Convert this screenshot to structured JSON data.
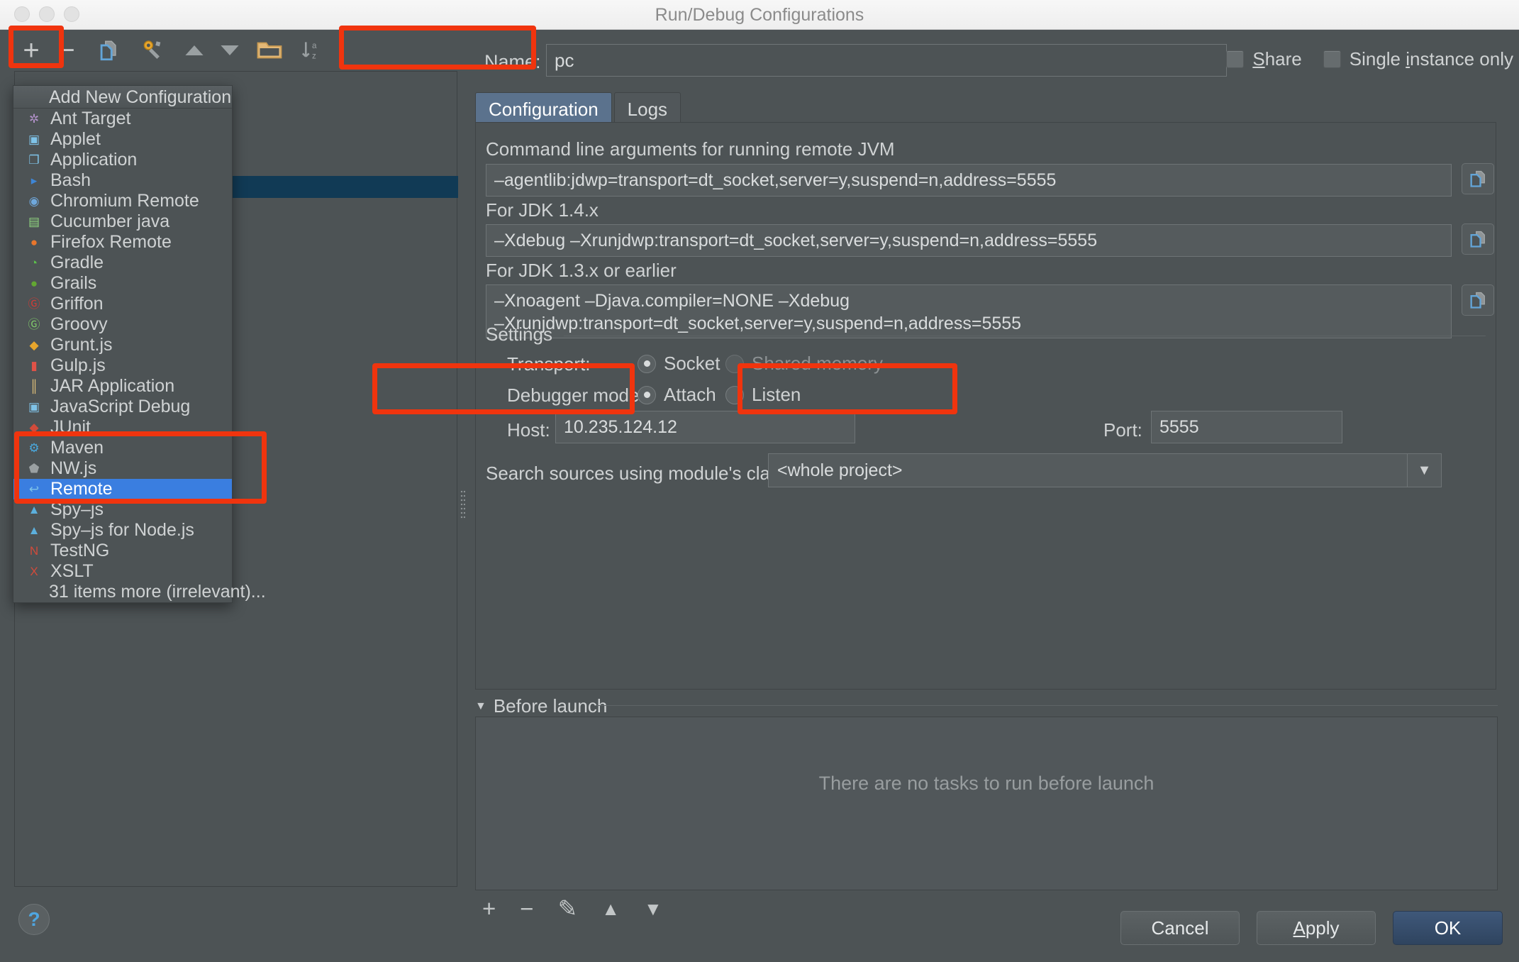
{
  "window": {
    "title": "Run/Debug Configurations"
  },
  "toolbar": {
    "add_label": "+",
    "remove_label": "−",
    "icons": [
      "copy-configuration-icon",
      "edit-templates-icon",
      "move-up-icon",
      "move-down-icon",
      "folder-icon",
      "sort-alphabetically-icon"
    ]
  },
  "menu": {
    "header": "Add New Configuration",
    "items": [
      {
        "label": "Ant Target",
        "icon": "ant-icon",
        "glyph": "✲",
        "color": "#b090c8"
      },
      {
        "label": "Applet",
        "icon": "applet-icon",
        "glyph": "▣",
        "color": "#7fc3e8"
      },
      {
        "label": "Application",
        "icon": "application-icon",
        "glyph": "❐",
        "color": "#7fc3e8"
      },
      {
        "label": "Bash",
        "icon": "bash-terminal-icon",
        "glyph": "▸",
        "color": "#3e86d6"
      },
      {
        "label": "Chromium Remote",
        "icon": "chromium-icon",
        "glyph": "◉",
        "color": "#6fa8dc"
      },
      {
        "label": "Cucumber java",
        "icon": "cucumber-icon",
        "glyph": "▤",
        "color": "#8fd47f"
      },
      {
        "label": "Firefox Remote",
        "icon": "firefox-icon",
        "glyph": "●",
        "color": "#e8762c"
      },
      {
        "label": "Gradle",
        "icon": "gradle-icon",
        "glyph": "◔",
        "color": "#5bbf4b"
      },
      {
        "label": "Grails",
        "icon": "grails-icon",
        "glyph": "●",
        "color": "#63a832"
      },
      {
        "label": "Griffon",
        "icon": "griffon-icon",
        "glyph": "Ⓖ",
        "color": "#d13b36"
      },
      {
        "label": "Groovy",
        "icon": "groovy-icon",
        "glyph": "Ⓖ",
        "color": "#7fc96a"
      },
      {
        "label": "Grunt.js",
        "icon": "grunt-icon",
        "glyph": "◆",
        "color": "#e8a62c"
      },
      {
        "label": "Gulp.js",
        "icon": "gulp-icon",
        "glyph": "▮",
        "color": "#e05247"
      },
      {
        "label": "JAR Application",
        "icon": "jar-icon",
        "glyph": "║",
        "color": "#e0c07a"
      },
      {
        "label": "JavaScript Debug",
        "icon": "javascript-debug-icon",
        "glyph": "▣",
        "color": "#7fc3e8"
      },
      {
        "label": "JUnit",
        "icon": "junit-icon",
        "glyph": "◆",
        "color": "#d14b3b"
      },
      {
        "label": "Maven",
        "icon": "maven-icon",
        "glyph": "⚙",
        "color": "#4aa8dd"
      },
      {
        "label": "NW.js",
        "icon": "nwjs-icon",
        "glyph": "⬟",
        "color": "#9aa0a2"
      },
      {
        "label": "Remote",
        "icon": "remote-icon",
        "glyph": "↩",
        "color": "#7fc3e8",
        "selected": true
      },
      {
        "label": "Spy–js",
        "icon": "spyjs-icon",
        "glyph": "▲",
        "color": "#5cb0dd"
      },
      {
        "label": "Spy–js for Node.js",
        "icon": "spyjs-node-icon",
        "glyph": "▲",
        "color": "#5cb0dd"
      },
      {
        "label": "TestNG",
        "icon": "testng-icon",
        "glyph": "N",
        "color": "#d14b3b"
      },
      {
        "label": "XSLT",
        "icon": "xslt-icon",
        "glyph": "X",
        "color": "#d14b3b"
      },
      {
        "label": "31 items more (irrelevant)...",
        "icon": "more-items-icon",
        "glyph": "",
        "color": "#cfd2d3",
        "no_icon": true
      }
    ]
  },
  "name_row": {
    "label": "Name:",
    "value": "pc",
    "share_label": "Share",
    "share_underline": "S",
    "single_instance_label": "Single instance only"
  },
  "tabs": [
    {
      "label": "Configuration",
      "active": true
    },
    {
      "label": "Logs",
      "active": false
    }
  ],
  "configuration": {
    "cmdline_label": "Command line arguments for running remote JVM",
    "cmdline_value": "–agentlib:jdwp=transport=dt_socket,server=y,suspend=n,address=5555",
    "jdk14_label": "For JDK 1.4.x",
    "jdk14_value": "–Xdebug –Xrunjdwp:transport=dt_socket,server=y,suspend=n,address=5555",
    "jdk13_label": "For JDK 1.3.x or earlier",
    "jdk13_value": "–Xnoagent –Djava.compiler=NONE –Xdebug\n–Xrunjdwp:transport=dt_socket,server=y,suspend=n,address=5555",
    "settings_group": "Settings",
    "transport_label": "Transport:",
    "transport_socket": "Socket",
    "transport_shared_memory": "Shared memory",
    "debugger_mode_label": "Debugger mode:",
    "debugger_attach": "Attach",
    "debugger_listen": "Listen",
    "host_label": "Host:",
    "host_value": "10.235.124.12",
    "port_label": "Port:",
    "port_value": "5555",
    "search_sources_label": "Search sources using module's classpath:",
    "search_sources_value": "<whole project>"
  },
  "before_launch": {
    "title": "Before launch",
    "empty_text": "There are no tasks to run before launch",
    "toolbar": [
      "+",
      "−",
      "✎",
      "▲",
      "▼"
    ]
  },
  "footer": {
    "help_label": "?",
    "cancel_label": "Cancel",
    "apply_label": "Apply",
    "apply_underline": "A",
    "ok_label": "OK"
  },
  "colors": {
    "accent_selection": "#3a7ee0",
    "inactive_selection": "#113a55",
    "annotation_red": "#f0340e",
    "primary_button": "#3f587a"
  }
}
